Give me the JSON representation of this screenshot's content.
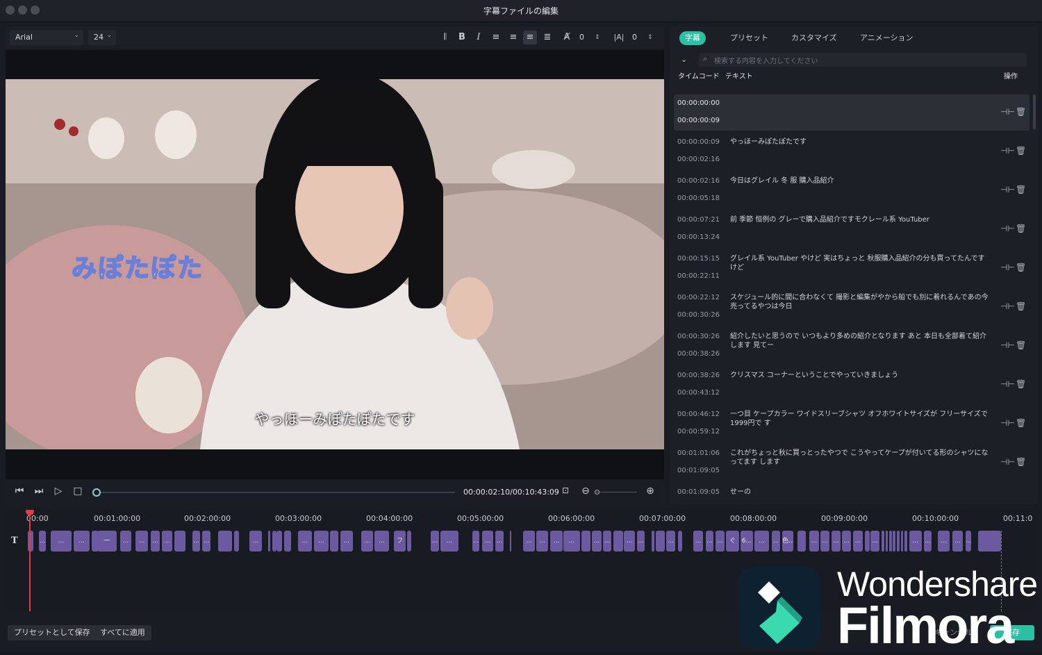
{
  "window": {
    "title": "字幕ファイルの編集"
  },
  "format": {
    "font": "Arial",
    "size": "24",
    "spacing_value": "0",
    "line_value": "0"
  },
  "video": {
    "overlay_text": "みぽたぽた",
    "subtitle": "やっほーみぽたぽたです"
  },
  "player": {
    "timecode": "00:00:02:10/00:10:43:09",
    "progress_fraction": 0.0
  },
  "tabs": [
    "字幕",
    "プリセット",
    "カスタマイズ",
    "アニメーション"
  ],
  "search": {
    "placeholder": "検索する内容を入力してください"
  },
  "table_headers": {
    "timecode": "タイムコード",
    "text": "テキスト",
    "action": "操作"
  },
  "subtitles": [
    {
      "start": "00:00:00:00",
      "end": "00:00:00:09",
      "text": ""
    },
    {
      "start": "00:00:00:09",
      "end": "00:00:02:16",
      "text": "やっほーみぽたぽたです"
    },
    {
      "start": "00:00:02:16",
      "end": "00:00:05:18",
      "text": "今日はグレイル 冬 服 購入品紹介"
    },
    {
      "start": "00:00:07:21",
      "end": "00:00:13:24",
      "text": "前 季節 恒例の グレーで購入品紹介ですモクレール系 YouTuber"
    },
    {
      "start": "00:00:15:15",
      "end": "00:00:22:11",
      "text": "グレイル系 YouTuber やけど 実はちょっと 秋服購入品紹介の分も買ってたんです けど"
    },
    {
      "start": "00:00:22:12",
      "end": "00:00:30:26",
      "text": "スケジュール的に間に合わなくて 撮影と編集がやから船でも別に着れるんであの今売ってるやつは今日"
    },
    {
      "start": "00:00:30:26",
      "end": "00:00:38:26",
      "text": "紹介したいと思うので いつもより多めの紹介となります あと 本日も全部着て紹介します 見てー"
    },
    {
      "start": "00:00:38:26",
      "end": "00:00:43:12",
      "text": "クリスマス コーナーということでやっていきましょう"
    },
    {
      "start": "00:00:46:12",
      "end": "00:00:59:12",
      "text": "一つ目 ケープカラー ワイドスリーブシャツ オフホワイトサイズが フリーサイズで 1999円で す"
    },
    {
      "start": "00:01:01:06",
      "end": "00:01:09:05",
      "text": "これがちょっと秋に買っとったやつで こうやってケープが付いてる形のシャツになってます します"
    },
    {
      "start": "00:01:09:05",
      "end": "",
      "text": "せーの"
    }
  ],
  "timeline": {
    "ticks": [
      "00:00",
      "00:01:00:00",
      "00:02:00:00",
      "00:03:00:00",
      "00:04:00:00",
      "00:05:00:00",
      "00:06:00:00",
      "00:07:00:00",
      "00:08:00:00",
      "00:09:00:00",
      "00:10:00:00",
      "00:11:0"
    ],
    "clip_labels": {
      "a": "...",
      "b": "一",
      "c": "フ",
      "d": "ぐ",
      "e": "6...",
      "f": "色..."
    }
  },
  "footer": {
    "save_preset": "プリセットとして保存",
    "apply_all": "すべてに適用",
    "cancel": "キャンセル",
    "save": "保存"
  },
  "watermark": {
    "line1": "Wondershare",
    "line2": "Filmora"
  },
  "colors": {
    "accent": "#2bbfa4",
    "clip": "#6c5aa0",
    "playhead": "#e23b40"
  }
}
